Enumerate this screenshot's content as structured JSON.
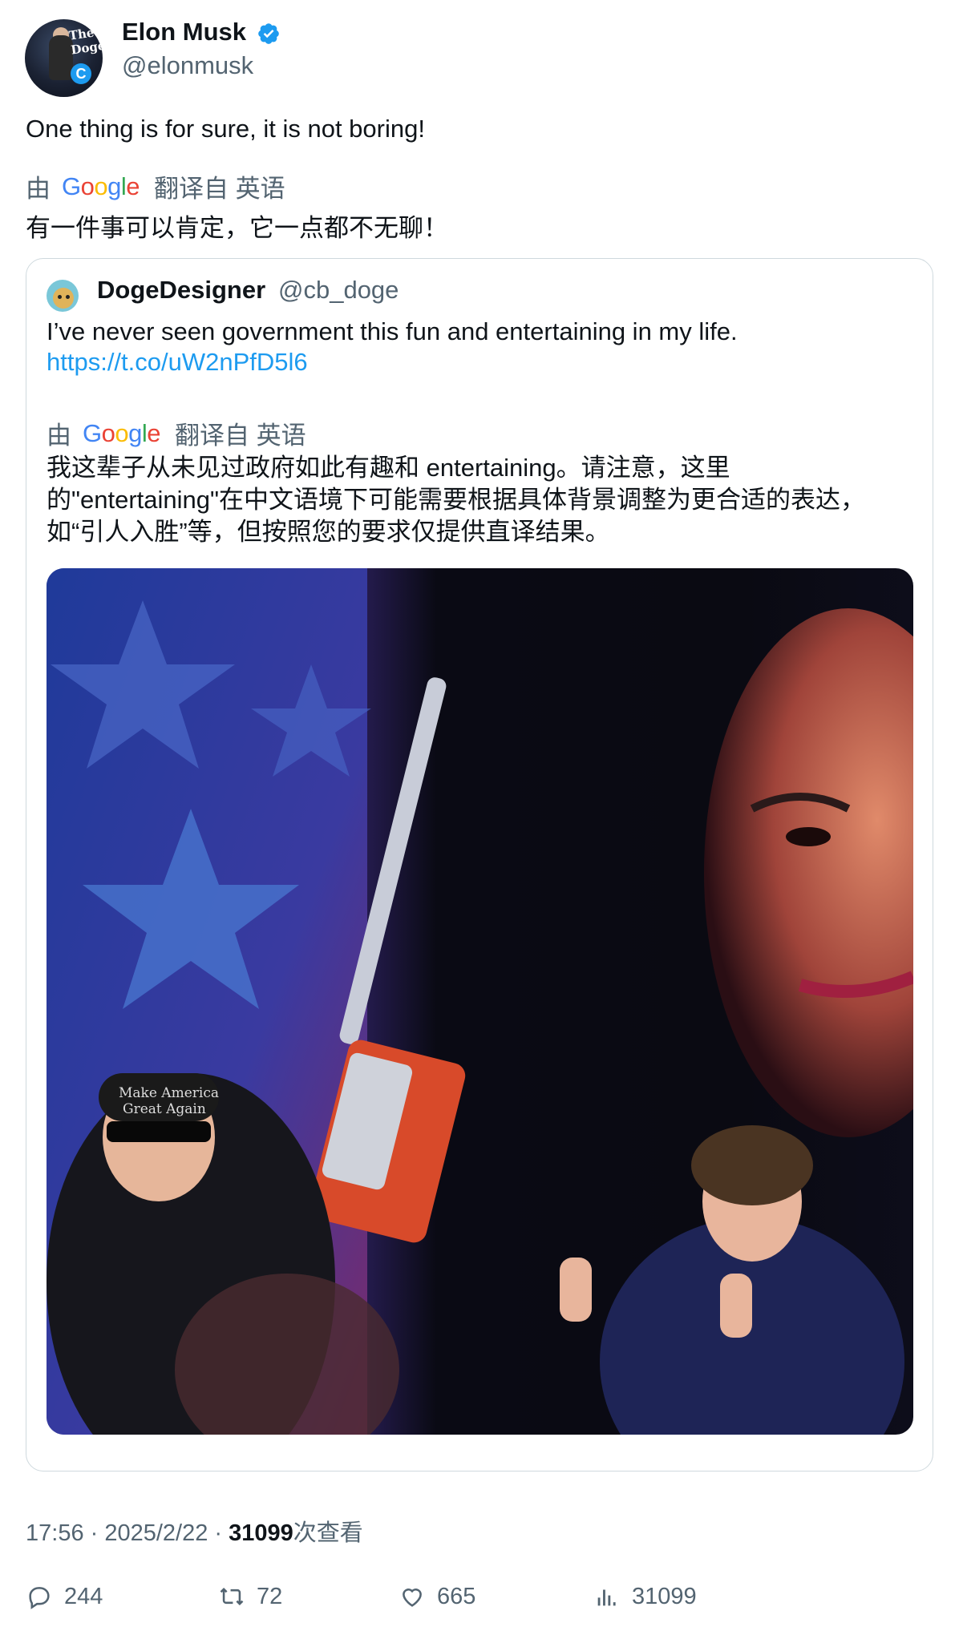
{
  "author": {
    "name": "Elon Musk",
    "handle": "@elonmusk",
    "avatar_text": "The DogeF",
    "avatar_badge": "C"
  },
  "tweet": {
    "text": "One thing is for sure, it is not boring!",
    "translate_prefix": "由",
    "translate_brand": "Google",
    "translate_suffix": "翻译自 英语",
    "translated_text": "有一件事可以肯定，它一点都不无聊！"
  },
  "quote": {
    "name": "DogeDesigner",
    "handle": "@cb_doge",
    "text": "I’ve never seen government this fun and entertaining in my life.",
    "link": "https://t.co/uW2nPfD5l6",
    "translate_prefix": "由",
    "translate_brand": "Google",
    "translate_suffix": "翻译自 英语",
    "translated_lines": [
      "我这辈子从未见过政府如此有趣和 entertaining。请注意，这里",
      "的\"entertaining\"在中文语境下可能需要根据具体背景调整为更合适的表达，",
      "如“引人入胜”等，但按照您的要求仅提供直译结果。"
    ],
    "media": {
      "hat_line1": "Make America",
      "hat_line2": "Great Again"
    }
  },
  "meta": {
    "time_date": "17:56 · 2025/2/22 · ",
    "views_count": "31099",
    "views_label": "次查看"
  },
  "actions": {
    "replies": "244",
    "retweets": "72",
    "likes": "665",
    "views": "31099"
  },
  "colors": {
    "accent": "#1d9bf0",
    "secondary_text": "#536471",
    "border": "#cfd9de"
  }
}
